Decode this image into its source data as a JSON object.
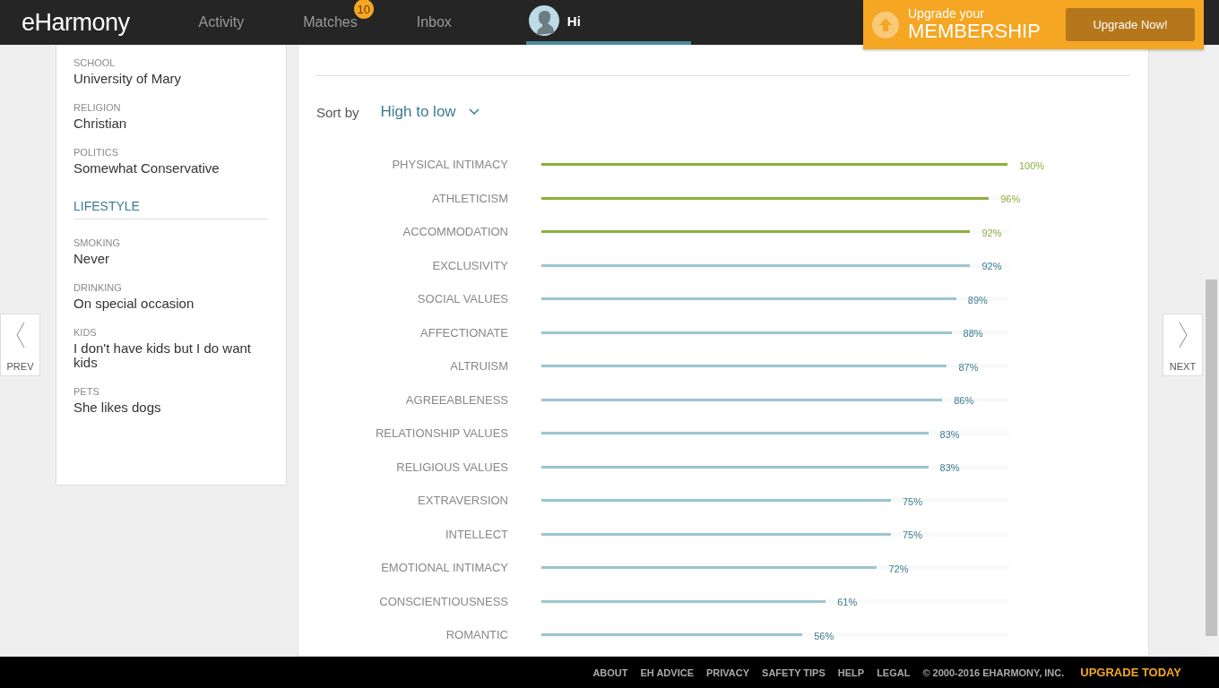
{
  "nav": {
    "logo": "eHarmony",
    "items": [
      {
        "label": "Activity"
      },
      {
        "label": "Matches",
        "badge": "10"
      },
      {
        "label": "Inbox"
      }
    ],
    "user": "Hi"
  },
  "upgrade": {
    "line1": "Upgrade your",
    "line2": "MEMBERSHIP",
    "button": "Upgrade Now!"
  },
  "profile": {
    "fields": [
      {
        "label": "SCHOOL",
        "value": "University of Mary"
      },
      {
        "label": "RELIGION",
        "value": "Christian"
      },
      {
        "label": "POLITICS",
        "value": "Somewhat Conservative"
      }
    ],
    "section": "LIFESTYLE",
    "lifestyle": [
      {
        "label": "SMOKING",
        "value": "Never"
      },
      {
        "label": "DRINKING",
        "value": "On special occasion"
      },
      {
        "label": "KIDS",
        "value": "I don't have kids but I do want kids"
      },
      {
        "label": "PETS",
        "value": "She likes dogs"
      }
    ]
  },
  "sort": {
    "label": "Sort by",
    "value": "High to low"
  },
  "traits": [
    {
      "name": "PHYSICAL INTIMACY",
      "level": 1.0,
      "value": "100%",
      "color": "#8cb03c"
    },
    {
      "name": "ATHLETICISM",
      "level": 0.96,
      "value": "96%",
      "color": "#8cb03c"
    },
    {
      "name": "ACCOMMODATION",
      "level": 0.92,
      "value": "92%",
      "color": "#8cb03c"
    },
    {
      "name": "EXCLUSIVITY",
      "level": 0.92,
      "value": "92%",
      "color": "#9cc5d0"
    },
    {
      "name": "SOCIAL VALUES",
      "level": 0.89,
      "value": "89%",
      "color": "#9cc5d0"
    },
    {
      "name": "AFFECTIONATE",
      "level": 0.88,
      "value": "88%",
      "color": "#9cc5d0"
    },
    {
      "name": "ALTRUISM",
      "level": 0.87,
      "value": "87%",
      "color": "#9cc5d0"
    },
    {
      "name": "AGREEABLENESS",
      "level": 0.86,
      "value": "86%",
      "color": "#9cc5d0"
    },
    {
      "name": "RELATIONSHIP VALUES",
      "level": 0.83,
      "value": "83%",
      "color": "#9cc5d0"
    },
    {
      "name": "RELIGIOUS VALUES",
      "level": 0.83,
      "value": "83%",
      "color": "#9cc5d0"
    },
    {
      "name": "EXTRAVERSION",
      "level": 0.75,
      "value": "75%",
      "color": "#9cc5d0"
    },
    {
      "name": "INTELLECT",
      "level": 0.75,
      "value": "75%",
      "color": "#9cc5d0"
    },
    {
      "name": "EMOTIONAL INTIMACY",
      "level": 0.72,
      "value": "72%",
      "color": "#9cc5d0"
    },
    {
      "name": "CONSCIENTIOUSNESS",
      "level": 0.61,
      "value": "61%",
      "color": "#9cc5d0"
    },
    {
      "name": "ROMANTIC",
      "level": 0.56,
      "value": "56%",
      "color": "#9cc5d0"
    }
  ],
  "pager": {
    "prev": "PREV",
    "next": "NEXT"
  },
  "footer": {
    "links": [
      "ABOUT",
      "EH ADVICE",
      "PRIVACY",
      "SAFETY TIPS",
      "HELP",
      "LEGAL"
    ],
    "copyright": "© 2000-2016 EHARMONY, INC.",
    "cta": "UPGRADE TODAY"
  }
}
